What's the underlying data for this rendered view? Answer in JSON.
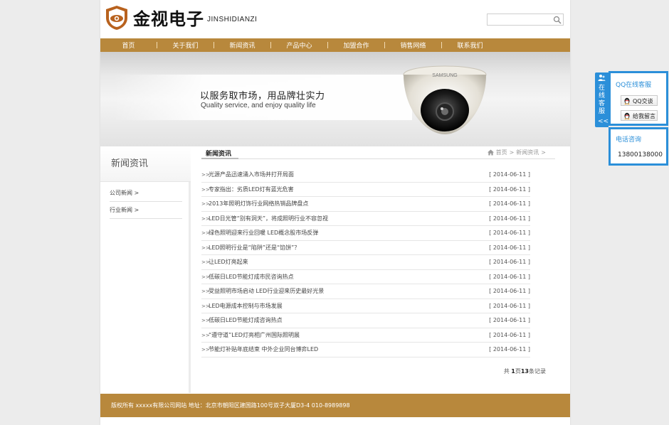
{
  "header": {
    "logo_cn": "金视电子",
    "logo_en": "JINSHIDIANZI",
    "search": {
      "placeholder": "",
      "value": ""
    }
  },
  "nav": {
    "items": [
      "首页",
      "关于我们",
      "新闻资讯",
      "产品中心",
      "加盟合作",
      "销售网络",
      "联系我们"
    ]
  },
  "banner": {
    "title": "以服务取市场，用品牌壮实力",
    "subtitle": "Quality service, and enjoy quality life",
    "camera_brand": "SAMSUNG"
  },
  "sidebar": {
    "title": "新闻资讯",
    "items": [
      "公司新闻 >",
      "行业新闻 >"
    ]
  },
  "content": {
    "title": "新闻资讯",
    "breadcrumb": {
      "home": "首页",
      "sep1": ">",
      "current": "新闻资讯",
      "sep2": ">"
    },
    "news": [
      {
        "title": "光源产品迅速涌入市场并打开局面",
        "date": "[ 2014-06-11 ]"
      },
      {
        "title": "专家指出：劣质LED灯有蓝光危害",
        "date": "[ 2014-06-11 ]"
      },
      {
        "title": "2013年照明灯饰行业网络热销品牌盘点",
        "date": "[ 2014-06-11 ]"
      },
      {
        "title": "LED日光管“别有洞天”，将成照明行业不容忽视",
        "date": "[ 2014-06-11 ]"
      },
      {
        "title": "绿色照明迎来行业回暖 LED概念股市场反弹",
        "date": "[ 2014-06-11 ]"
      },
      {
        "title": "LED照明行业是“陷阱”还是“馅饼”？",
        "date": "[ 2014-06-11 ]"
      },
      {
        "title": "让LED灯亮起来",
        "date": "[ 2014-06-11 ]"
      },
      {
        "title": "低碳日LED节能灯成市民咨询热点",
        "date": "[ 2014-06-11 ]"
      },
      {
        "title": "受益照明市场启动 LED行业迎来历史最好光景",
        "date": "[ 2014-06-11 ]"
      },
      {
        "title": "LED电源成本控制与市场发展",
        "date": "[ 2014-06-11 ]"
      },
      {
        "title": "低碳日LED节能灯成咨询热点",
        "date": "[ 2014-06-11 ]"
      },
      {
        "title": "“遵守道”LED灯亮相广州国际照明展",
        "date": "[ 2014-06-11 ]"
      },
      {
        "title": "节能灯补贴年底结束 中外企业同台博弈LED",
        "date": "[ 2014-06-11 ]"
      }
    ],
    "pager": {
      "prefix": "共 ",
      "pages": "1",
      "mid": "页",
      "count": "13",
      "suffix": "条记录"
    }
  },
  "footer": {
    "text": "版权所有 xxxxx有限公司网站 地址：北京市朝阳区建国路100号双子大厦D3-4 010-8989898"
  },
  "service": {
    "tab_text": "在线客服",
    "tab_arrow": "<<",
    "qq_title": "QQ在线客服",
    "qq_chat": "QQ交谈",
    "qq_message": "给我留言",
    "phone_title": "电话咨询",
    "phone_number": "13800138000"
  },
  "colors": {
    "brand": "#b8883c",
    "service_blue": "#2b8fd9",
    "background": "#ececec"
  }
}
